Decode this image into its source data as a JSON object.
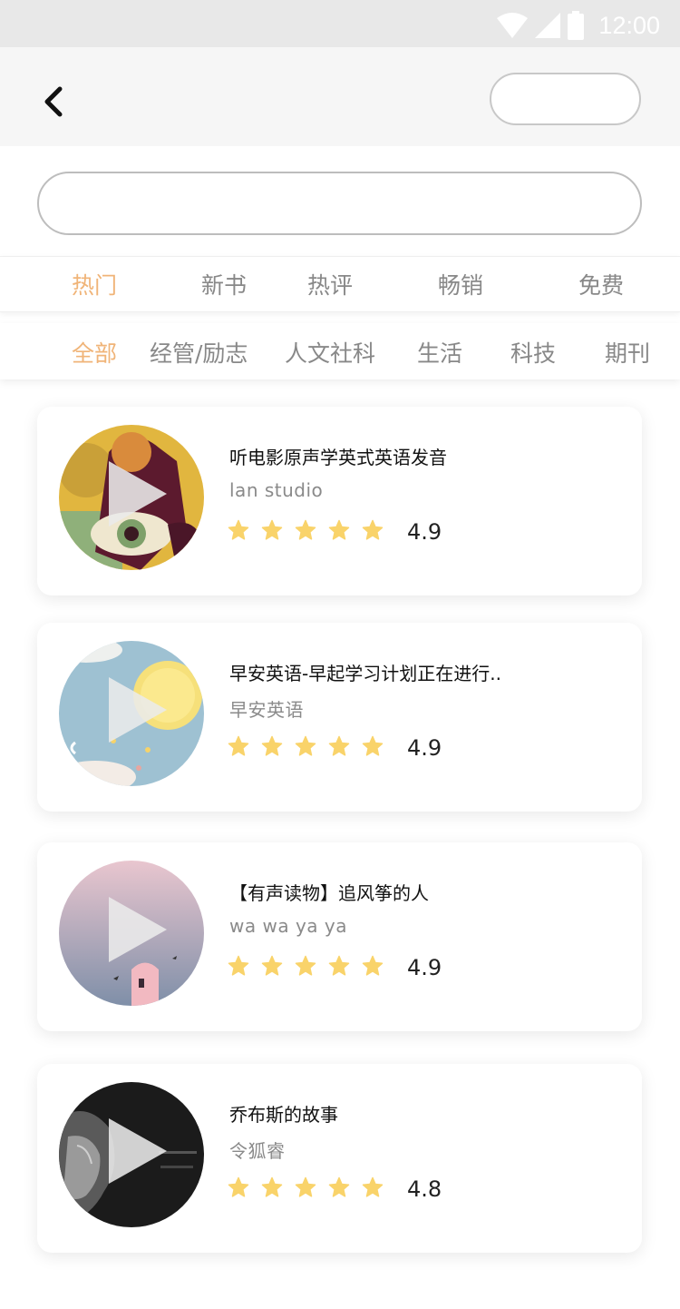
{
  "status_bar": {
    "time": "12:00",
    "background": "#e8e8e8"
  },
  "nav": {
    "back_icon": "chevron-left-icon",
    "action_label": ""
  },
  "search": {
    "placeholder": "",
    "value": ""
  },
  "tabs": [
    {
      "label": "热门",
      "active": true
    },
    {
      "label": "新书",
      "active": false
    },
    {
      "label": "热评",
      "active": false
    },
    {
      "label": "畅销",
      "active": false
    },
    {
      "label": "免费",
      "active": false
    }
  ],
  "categories": [
    {
      "label": "全部",
      "active": true
    },
    {
      "label": "经管/励志",
      "active": false
    },
    {
      "label": "人文社科",
      "active": false
    },
    {
      "label": "生活",
      "active": false
    },
    {
      "label": "科技",
      "active": false
    },
    {
      "label": "期刊",
      "active": false
    }
  ],
  "items": [
    {
      "title": "听电影原声学英式英语发音",
      "author": "lan studio",
      "stars": 5,
      "rating": "4.9"
    },
    {
      "title": "早安英语-早起学习计划正在进行..",
      "author": "早安英语",
      "stars": 5,
      "rating": "4.9"
    },
    {
      "title": "【有声读物】追风筝的人",
      "author": "wa wa ya ya",
      "stars": 5,
      "rating": "4.9"
    },
    {
      "title": "乔布斯的故事",
      "author": "令狐睿",
      "stars": 5,
      "rating": "4.8"
    }
  ],
  "colors": {
    "accent": "#f0b478",
    "star": "#f9d36a",
    "text": "#111111",
    "muted": "#888888"
  }
}
